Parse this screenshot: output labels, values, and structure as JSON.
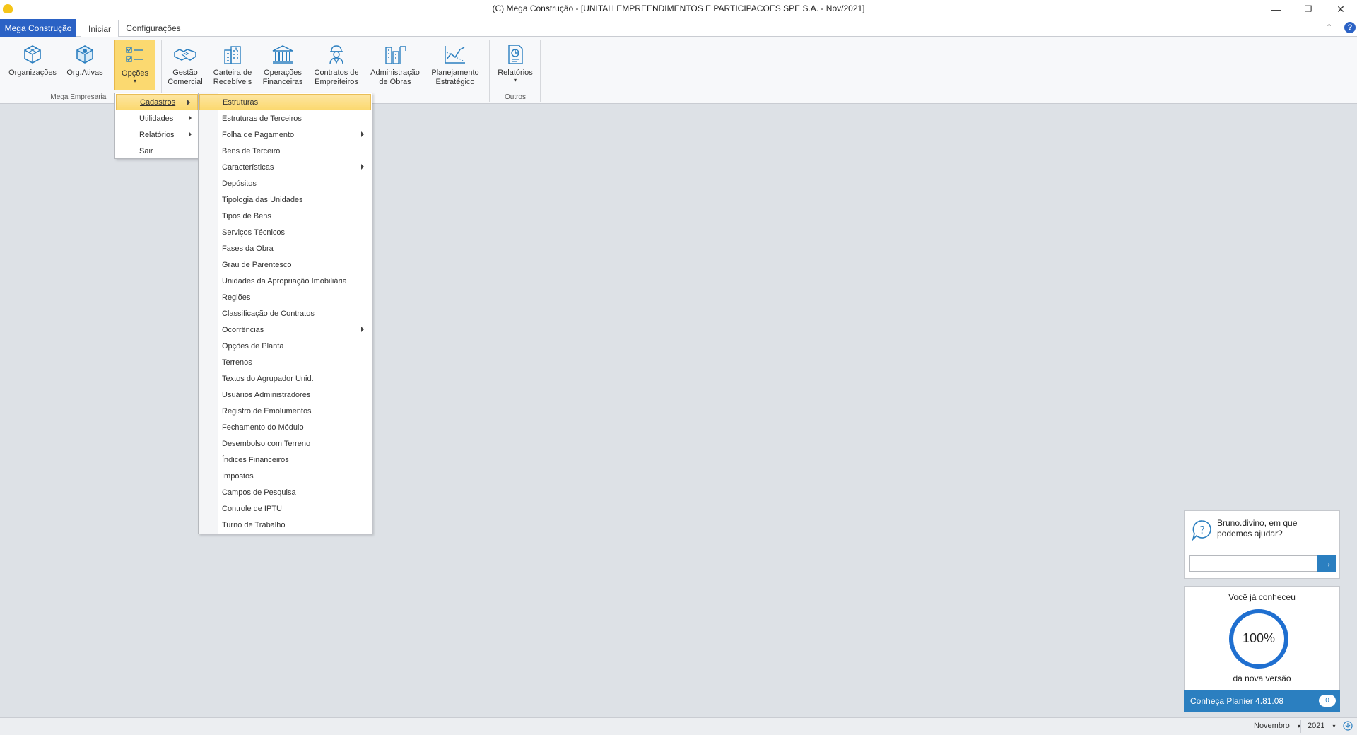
{
  "window": {
    "title": "(C)  Mega Construção - [UNITAH EMPREENDIMENTOS E PARTICIPACOES SPE S.A. - Nov/2021]",
    "minimize_glyph": "—",
    "restore_glyph": "❐",
    "close_glyph": "✕"
  },
  "tabs": {
    "app_tab": "Mega Construção",
    "iniciar": "Iniciar",
    "configuracoes": "Configurações"
  },
  "ribbon": {
    "buttons": [
      {
        "label": "Organizações",
        "icon": "cube-icon"
      },
      {
        "label": "Org.Ativas",
        "icon": "cube-active-icon"
      },
      {
        "label": "Opções",
        "icon": "checklist-icon"
      },
      {
        "label": "Gestão\nComercial",
        "icon": "handshake-icon"
      },
      {
        "label": "Carteira de\nRecebíveis",
        "icon": "building-dollar-icon"
      },
      {
        "label": "Operações\nFinanceiras",
        "icon": "bank-icon"
      },
      {
        "label": "Contratos de\nEmpreiteiros",
        "icon": "worker-icon"
      },
      {
        "label": "Administração\nde Obras",
        "icon": "construction-icon"
      },
      {
        "label": "Planejamento\nEstratégico",
        "icon": "chart-icon"
      },
      {
        "label": "Relatórios",
        "icon": "report-icon"
      }
    ],
    "groups": {
      "mega_empresarial": "Mega Empresarial",
      "outros": "Outros"
    }
  },
  "opcoes_menu": [
    {
      "label": "Cadastros",
      "submenu": true
    },
    {
      "label": "Utilidades",
      "submenu": true
    },
    {
      "label": "Relatórios",
      "submenu": true
    },
    {
      "label": "Sair",
      "submenu": false
    }
  ],
  "cadastros_menu": [
    {
      "label": "Estruturas",
      "submenu": false
    },
    {
      "label": "Estruturas de Terceiros",
      "submenu": false
    },
    {
      "label": "Folha de Pagamento",
      "submenu": true
    },
    {
      "label": "Bens de Terceiro",
      "submenu": false
    },
    {
      "label": "Características",
      "submenu": true
    },
    {
      "label": "Depósitos",
      "submenu": false
    },
    {
      "label": "Tipologia das Unidades",
      "submenu": false
    },
    {
      "label": "Tipos de Bens",
      "submenu": false
    },
    {
      "label": "Serviços Técnicos",
      "submenu": false
    },
    {
      "label": "Fases da Obra",
      "submenu": false
    },
    {
      "label": "Grau de Parentesco",
      "submenu": false
    },
    {
      "label": "Unidades da Apropriação Imobiliária",
      "submenu": false
    },
    {
      "label": "Regiões",
      "submenu": false
    },
    {
      "label": "Classificação de Contratos",
      "submenu": false
    },
    {
      "label": "Ocorrências",
      "submenu": true
    },
    {
      "label": "Opções de Planta",
      "submenu": false
    },
    {
      "label": "Terrenos",
      "submenu": false
    },
    {
      "label": "Textos do Agrupador Unid.",
      "submenu": false
    },
    {
      "label": "Usuários Administradores",
      "submenu": false
    },
    {
      "label": "Registro de Emolumentos",
      "submenu": false
    },
    {
      "label": "Fechamento do Módulo",
      "submenu": false
    },
    {
      "label": "Desembolso com Terreno",
      "submenu": false
    },
    {
      "label": "Índices Financeiros",
      "submenu": false
    },
    {
      "label": "Impostos",
      "submenu": false
    },
    {
      "label": "Campos de Pesquisa",
      "submenu": false
    },
    {
      "label": "Controle de IPTU",
      "submenu": false
    },
    {
      "label": "Turno de Trabalho",
      "submenu": false
    }
  ],
  "help_widget": {
    "prompt": "Bruno.divino, em que podemos ajudar?",
    "input_value": "",
    "go_glyph": "→"
  },
  "version_widget": {
    "top_text": "Você já conheceu",
    "percent": "100%",
    "percent_value": 1.0,
    "bottom_text": "da nova versão",
    "link_text": "Conheça Planier 4.81.08",
    "badge": "0"
  },
  "statusbar": {
    "month": "Novembro",
    "year": "2021"
  },
  "colors": {
    "accent_blue": "#2b62c5",
    "highlight_yellow": "#fbd970",
    "widget_blue": "#2b7fc0",
    "ring_blue": "#1f6fd0"
  }
}
